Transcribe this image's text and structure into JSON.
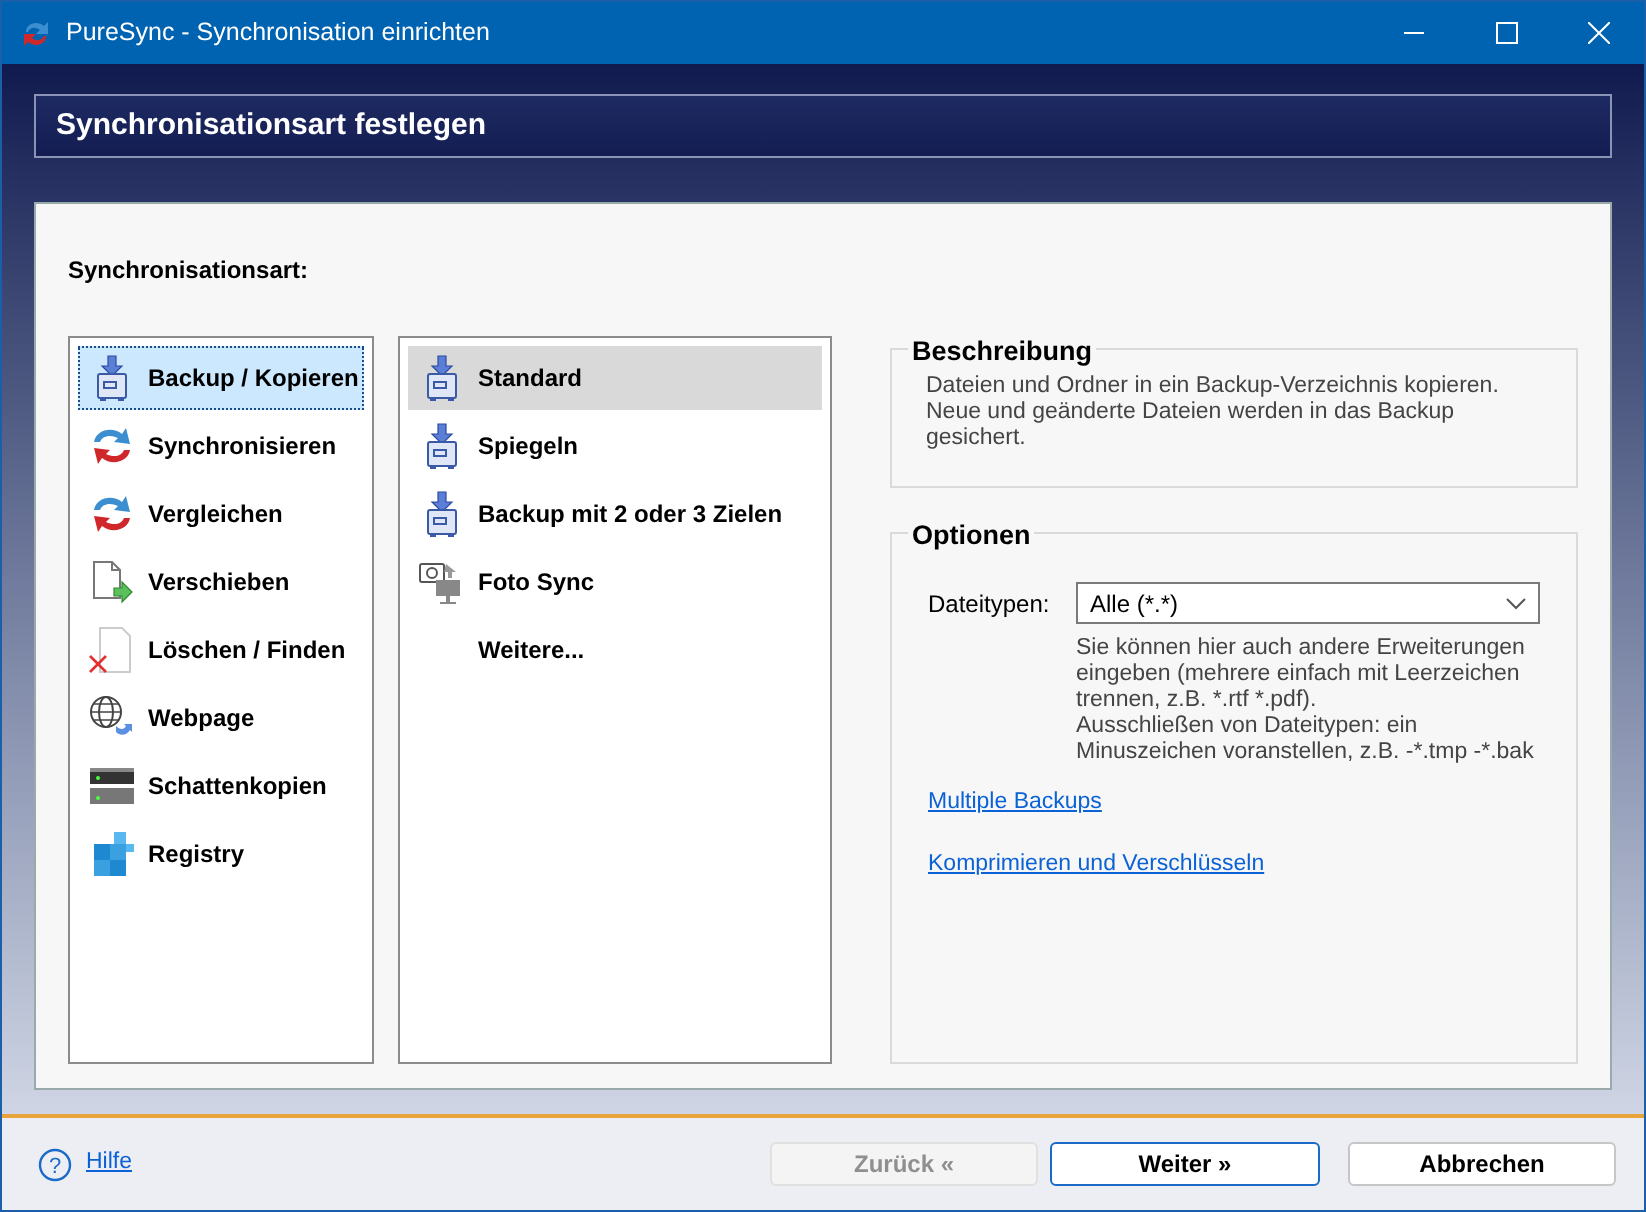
{
  "window": {
    "title": "PureSync - Synchronisation einrichten"
  },
  "header": {
    "title": "Synchronisationsart festlegen"
  },
  "section_label": "Synchronisationsart:",
  "sync_types": [
    {
      "label": "Backup / Kopieren",
      "selected": true
    },
    {
      "label": "Synchronisieren",
      "selected": false
    },
    {
      "label": "Vergleichen",
      "selected": false
    },
    {
      "label": "Verschieben",
      "selected": false
    },
    {
      "label": "Löschen / Finden",
      "selected": false
    },
    {
      "label": "Webpage",
      "selected": false
    },
    {
      "label": "Schattenkopien",
      "selected": false
    },
    {
      "label": "Registry",
      "selected": false
    }
  ],
  "variants": [
    {
      "label": "Standard",
      "selected": true
    },
    {
      "label": "Spiegeln",
      "selected": false
    },
    {
      "label": "Backup mit 2 oder 3 Zielen",
      "selected": false
    },
    {
      "label": "Foto Sync",
      "selected": false
    },
    {
      "label": "Weitere...",
      "selected": false
    }
  ],
  "description": {
    "title": "Beschreibung",
    "text": "Dateien und Ordner in ein Backup-Verzeichnis kopieren. Neue und geänderte Dateien werden in das Backup gesichert."
  },
  "options": {
    "title": "Optionen",
    "file_types_label": "Dateitypen:",
    "file_types_value": "Alle (*.*)",
    "hint_lines": [
      "Sie können hier auch andere Erweiterungen eingeben (mehrere einfach mit Leerzeichen trennen, z.B. *.rtf *.pdf).",
      "Ausschließen von Dateitypen: ein Minuszeichen voranstellen, z.B. -*.tmp -*.bak"
    ],
    "links": [
      "Multiple Backups",
      "Komprimieren und Verschlüsseln"
    ]
  },
  "footer": {
    "help_icon": "?",
    "help_link": "Hilfe",
    "buttons": [
      {
        "label": "Zurück «",
        "disabled": true,
        "default": false
      },
      {
        "label": "Weiter »",
        "disabled": false,
        "default": true
      },
      {
        "label": "Abbrechen",
        "disabled": false,
        "default": false
      }
    ]
  }
}
